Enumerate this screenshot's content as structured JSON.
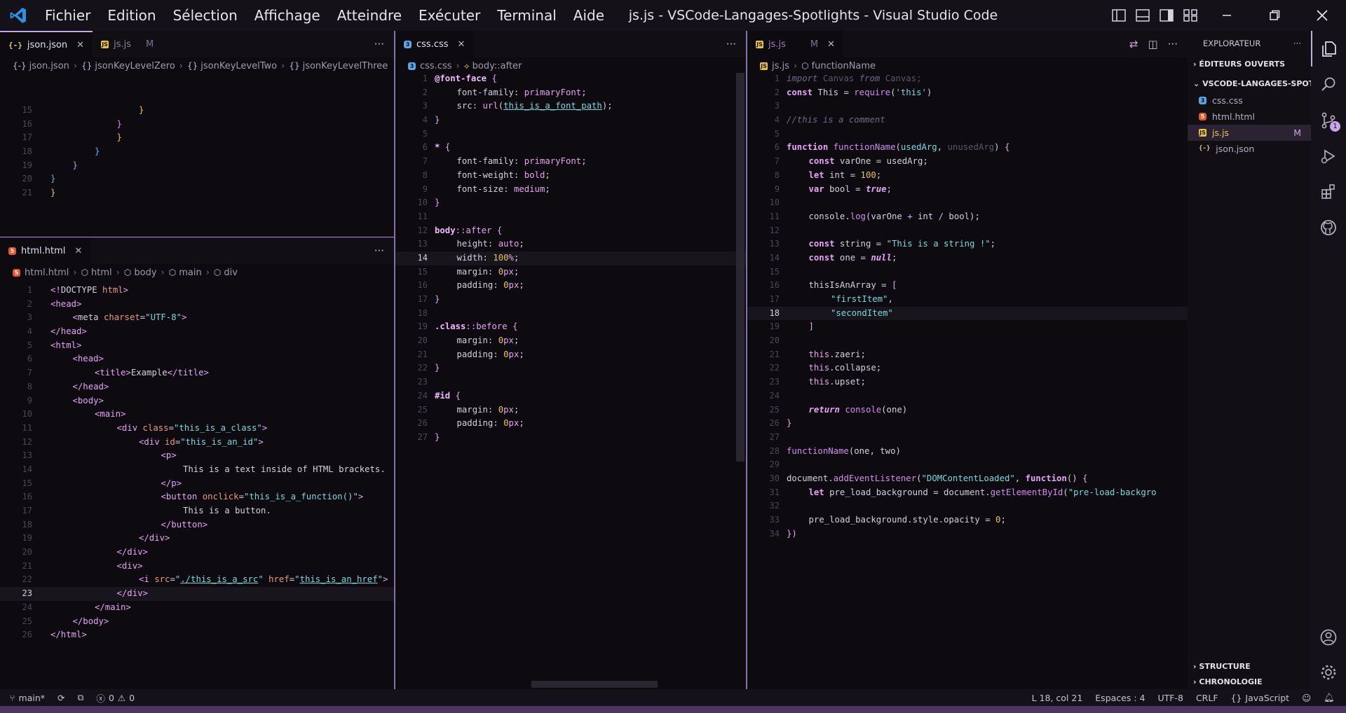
{
  "window": {
    "title": "js.js - VSCode-Langages-Spotlights - Visual Studio Code"
  },
  "menu": [
    "Fichier",
    "Edition",
    "Sélection",
    "Affichage",
    "Atteindre",
    "Exécuter",
    "Terminal",
    "Aide"
  ],
  "icons": {
    "logo": "vscode-logo-icon",
    "close": "close-icon"
  },
  "colors": {
    "accent": "#c9a6e8",
    "keyword": "#e6a3f7",
    "string": "#7ad8e0",
    "number": "#e7c45a"
  },
  "pane_json": {
    "tabs": [
      {
        "label": "json.json"
      },
      {
        "label": "js.js",
        "badge": "M"
      }
    ],
    "breadcrumb": [
      "json.json",
      "jsonKeyLevelZero",
      "jsonKeyLevelTwo",
      "jsonKeyLevelThree"
    ],
    "lines": [
      {
        "n": "15",
        "indent": 4,
        "html": "<span class='brk1'>}</span>"
      },
      {
        "n": "16",
        "indent": 3,
        "html": "<span class='brk2'>}</span>"
      },
      {
        "n": "17",
        "indent": 3,
        "html": "<span class='brk1'>}</span>"
      },
      {
        "n": "18",
        "indent": 2,
        "html": "<span class='brk3'>}</span>"
      },
      {
        "n": "19",
        "indent": 1,
        "html": "<span class='brk2'>}</span>"
      },
      {
        "n": "20",
        "indent": 0,
        "html": "<span class='brk3'>}</span>"
      },
      {
        "n": "21",
        "indent": 0,
        "html": "<span class='brk1'>}</span>"
      }
    ]
  },
  "pane_html": {
    "tabs": [
      {
        "label": "html.html"
      }
    ],
    "breadcrumb": [
      "html.html",
      "html",
      "body",
      "main",
      "div"
    ],
    "lines": [
      {
        "n": "1",
        "i": 0,
        "html": "<span class='tag'>&lt;!</span>DOCTYPE <span class='attr'>html</span><span class='tag'>&gt;</span>"
      },
      {
        "n": "2",
        "i": 0,
        "html": "<span class='tag'>&lt;head&gt;</span>"
      },
      {
        "n": "3",
        "i": 1,
        "html": "<span class='tag'>&lt;</span>meta <span class='attr'>charset</span>=<span class='str'>\"UTF-8\"</span><span class='tag'>&gt;</span>"
      },
      {
        "n": "4",
        "i": 0,
        "html": "<span class='tag'>&lt;/head&gt;</span>"
      },
      {
        "n": "5",
        "i": 0,
        "html": "<span class='tag'>&lt;html&gt;</span>"
      },
      {
        "n": "6",
        "i": 1,
        "html": "<span class='tag'>&lt;head&gt;</span>"
      },
      {
        "n": "7",
        "i": 2,
        "html": "<span class='tag'>&lt;title&gt;</span>Example<span class='tag'>&lt;/title&gt;</span>"
      },
      {
        "n": "8",
        "i": 1,
        "html": "<span class='tag'>&lt;/head&gt;</span>"
      },
      {
        "n": "9",
        "i": 1,
        "html": "<span class='tag'>&lt;body&gt;</span>"
      },
      {
        "n": "10",
        "i": 2,
        "html": "<span class='tag'>&lt;main&gt;</span>"
      },
      {
        "n": "11",
        "i": 3,
        "html": "<span class='tag'>&lt;div</span> <span class='attr'>class</span>=<span class='str'>\"this_is_a_class\"</span><span class='tag'>&gt;</span>"
      },
      {
        "n": "12",
        "i": 4,
        "html": "<span class='tag'>&lt;div</span> <span class='attr'>id</span>=<span class='str'>\"this_is_an_id\"</span><span class='tag'>&gt;</span>"
      },
      {
        "n": "13",
        "i": 5,
        "html": "<span class='tag'>&lt;p&gt;</span>"
      },
      {
        "n": "14",
        "i": 6,
        "html": "This is a text inside of HTML brackets."
      },
      {
        "n": "15",
        "i": 5,
        "html": "<span class='tag'>&lt;/p&gt;</span>"
      },
      {
        "n": "16",
        "i": 5,
        "html": "<span class='tag'>&lt;button</span> <span class='attr'>onclick</span>=<span class='str'>\"this_is_a_function()\"</span><span class='tag'>&gt;</span>"
      },
      {
        "n": "17",
        "i": 6,
        "html": "This is a button."
      },
      {
        "n": "18",
        "i": 5,
        "html": "<span class='tag'>&lt;/button&gt;</span>"
      },
      {
        "n": "19",
        "i": 4,
        "html": "<span class='tag'>&lt;/div&gt;</span>"
      },
      {
        "n": "20",
        "i": 3,
        "html": "<span class='tag'>&lt;/div&gt;</span>"
      },
      {
        "n": "21",
        "i": 3,
        "html": "<span class='tag'>&lt;div&gt;</span>"
      },
      {
        "n": "22",
        "i": 4,
        "html": "<span class='tag'>&lt;i</span> <span class='attr'>src</span>=<span class='str'>\"<span class='link'>./this_is_a_src</span>\"</span> <span class='attr'>href</span>=<span class='str'>\"<span class='link'>this_is_an_href</span>\"</span><span class='tag'>&gt;</span>"
      },
      {
        "n": "23",
        "i": 3,
        "cur": true,
        "html": "<span class='tag'>&lt;/div&gt;</span>"
      },
      {
        "n": "24",
        "i": 2,
        "html": "<span class='tag'>&lt;/main&gt;</span>"
      },
      {
        "n": "25",
        "i": 1,
        "html": "<span class='tag'>&lt;/body&gt;</span>"
      },
      {
        "n": "26",
        "i": 0,
        "html": "<span class='tag'>&lt;/html&gt;</span>"
      }
    ]
  },
  "pane_css": {
    "tabs": [
      {
        "label": "css.css"
      }
    ],
    "breadcrumb": [
      "css.css",
      "body::after"
    ],
    "lines": [
      {
        "n": "1",
        "i": 0,
        "html": "<span class='sel'>@font-face</span> <span class='pun'>{</span>"
      },
      {
        "n": "2",
        "i": 1,
        "html": "font-family: <span class='val'>primaryFont</span>;"
      },
      {
        "n": "3",
        "i": 1,
        "html": "src: <span class='val'>url</span>(<span class='link'>this_is_a_font_path</span>);"
      },
      {
        "n": "4",
        "i": 0,
        "html": "<span class='pun'>}</span>"
      },
      {
        "n": "5",
        "i": 0,
        "html": ""
      },
      {
        "n": "6",
        "i": 0,
        "html": "<span class='sel'>*</span> <span class='pun'>{</span>"
      },
      {
        "n": "7",
        "i": 1,
        "html": "font-family: <span class='val'>primaryFont</span>;"
      },
      {
        "n": "8",
        "i": 1,
        "html": "font-weight: <span class='val'>bold</span>;"
      },
      {
        "n": "9",
        "i": 1,
        "html": "font-size: <span class='val'>medium</span>;"
      },
      {
        "n": "10",
        "i": 0,
        "html": "<span class='pun'>}</span>"
      },
      {
        "n": "11",
        "i": 0,
        "html": ""
      },
      {
        "n": "12",
        "i": 0,
        "html": "<span class='sel'>body</span><span class='pun'>::after</span> <span class='pun'>{</span>"
      },
      {
        "n": "13",
        "i": 1,
        "html": "height: <span class='val'>auto</span>;"
      },
      {
        "n": "14",
        "i": 1,
        "cur": true,
        "html": "width: <span class='num'>100</span><span class='val'>%</span>;"
      },
      {
        "n": "15",
        "i": 1,
        "html": "margin: <span class='num'>0</span><span class='val'>px</span>;"
      },
      {
        "n": "16",
        "i": 1,
        "html": "padding: <span class='num'>0</span><span class='val'>px</span>;"
      },
      {
        "n": "17",
        "i": 0,
        "html": "<span class='pun'>}</span>"
      },
      {
        "n": "18",
        "i": 0,
        "html": ""
      },
      {
        "n": "19",
        "i": 0,
        "html": "<span class='sel'>.class</span><span class='pun'>::before</span> <span class='pun'>{</span>"
      },
      {
        "n": "20",
        "i": 1,
        "html": "margin: <span class='num'>0</span><span class='val'>px</span>;"
      },
      {
        "n": "21",
        "i": 1,
        "html": "padding: <span class='num'>0</span><span class='val'>px</span>;"
      },
      {
        "n": "22",
        "i": 0,
        "html": "<span class='pun'>}</span>"
      },
      {
        "n": "23",
        "i": 0,
        "html": ""
      },
      {
        "n": "24",
        "i": 0,
        "html": "<span class='sel'>#id</span> <span class='pun'>{</span>"
      },
      {
        "n": "25",
        "i": 1,
        "html": "margin: <span class='num'>0</span><span class='val'>px</span>;"
      },
      {
        "n": "26",
        "i": 1,
        "html": "padding: <span class='num'>0</span><span class='val'>px</span>;"
      },
      {
        "n": "27",
        "i": 0,
        "html": "<span class='pun'>}</span>"
      }
    ]
  },
  "pane_js": {
    "tabs": [
      {
        "label": "js.js",
        "badge": "M"
      }
    ],
    "breadcrumb": [
      "js.js",
      "functionName"
    ],
    "lines": [
      {
        "n": "1",
        "i": 0,
        "html": "<span class='cm'>import</span> <span class='dim'>Canvas</span> <span class='cm'>from</span> <span class='dim'>Canvas</span><span class='dim'>;</span>"
      },
      {
        "n": "2",
        "i": 0,
        "html": "<span class='kw'>const</span> This = <span class='fn'>require</span>(<span class='str'>'this'</span>)"
      },
      {
        "n": "3",
        "i": 0,
        "html": ""
      },
      {
        "n": "4",
        "i": 0,
        "html": "<span class='cm'>//this is a comment</span>"
      },
      {
        "n": "5",
        "i": 0,
        "html": ""
      },
      {
        "n": "6",
        "i": 0,
        "html": "<span class='kw'>function</span> <span class='fn'>functionName</span>(<span class='str'>usedArg</span>, <span class='dim'>unusedArg</span>) <span class='pun'>{</span>"
      },
      {
        "n": "7",
        "i": 1,
        "html": "<span class='kw'>const</span> varOne = usedArg;"
      },
      {
        "n": "8",
        "i": 1,
        "html": "<span class='kw'>let</span> int = <span class='num'>100</span>;"
      },
      {
        "n": "9",
        "i": 1,
        "html": "<span class='kw'>var</span> bool = <span class='kwi'>true</span>;"
      },
      {
        "n": "10",
        "i": 0,
        "html": ""
      },
      {
        "n": "11",
        "i": 1,
        "html": "console.<span class='fn'>log</span>(varOne <span class='pun'>+</span> int <span class='pun'>/</span> bool);"
      },
      {
        "n": "12",
        "i": 0,
        "html": ""
      },
      {
        "n": "13",
        "i": 1,
        "html": "<span class='kw'>const</span> string = <span class='str'>\"This is a string !\"</span>;"
      },
      {
        "n": "14",
        "i": 1,
        "html": "<span class='kw'>const</span> one = <span class='kwi'>null</span>;"
      },
      {
        "n": "15",
        "i": 0,
        "html": ""
      },
      {
        "n": "16",
        "i": 1,
        "html": "thisIsAnArray = <span class='pun'>[</span>"
      },
      {
        "n": "17",
        "i": 2,
        "html": "<span class='str'>\"firstItem\"</span>,"
      },
      {
        "n": "18",
        "i": 2,
        "cur": true,
        "html": "<span class='str'>\"secondItem\"</span>"
      },
      {
        "n": "19",
        "i": 1,
        "html": "<span class='pun'>]</span>"
      },
      {
        "n": "20",
        "i": 0,
        "html": ""
      },
      {
        "n": "21",
        "i": 1,
        "html": "<span class='val'>this</span>.zaeri;"
      },
      {
        "n": "22",
        "i": 1,
        "html": "<span class='val'>this</span>.collapse;"
      },
      {
        "n": "23",
        "i": 1,
        "html": "<span class='val'>this</span>.upset;"
      },
      {
        "n": "24",
        "i": 0,
        "html": ""
      },
      {
        "n": "25",
        "i": 1,
        "html": "<span class='kwi'>return</span> <span class='fn'>console</span>(one)"
      },
      {
        "n": "26",
        "i": 0,
        "html": "<span class='pun'>}</span>"
      },
      {
        "n": "27",
        "i": 0,
        "html": ""
      },
      {
        "n": "28",
        "i": 0,
        "html": "<span class='fn'>functionName</span>(one, two)"
      },
      {
        "n": "29",
        "i": 0,
        "html": ""
      },
      {
        "n": "30",
        "i": 0,
        "html": "document.<span class='fn'>addEventListener</span>(<span class='str'>\"DOMContentLoaded\"</span>, <span class='kw'>function</span>() <span class='pun'>{</span>"
      },
      {
        "n": "31",
        "i": 1,
        "html": "<span class='kw'>let</span> pre_load_background = document.<span class='fn'>getElementById</span>(<span class='str'>\"pre-load-backgro</span>"
      },
      {
        "n": "32",
        "i": 0,
        "html": ""
      },
      {
        "n": "33",
        "i": 1,
        "html": "pre_load_background.style.opacity = <span class='num'>0</span>;"
      },
      {
        "n": "34",
        "i": 0,
        "html": "<span class='pun'>})</span>"
      }
    ]
  },
  "sidebar": {
    "title": "EXPLORATEUR",
    "sections": {
      "open": "ÉDITEURS OUVERTS",
      "workspace": "VSCODE-LANGAGES-SPOT...",
      "outline": "STRUCTURE",
      "timeline": "CHRONOLOGIE"
    },
    "files": [
      {
        "label": "css.css",
        "icon": "css"
      },
      {
        "label": "html.html",
        "icon": "html"
      },
      {
        "label": "js.js",
        "icon": "js",
        "badge": "M"
      },
      {
        "label": "json.json",
        "icon": "json"
      }
    ]
  },
  "activity": {
    "scm_badge": "1"
  },
  "status": {
    "branch": "main*",
    "errors": "0",
    "warnings": "0",
    "position": "L 18, col 21",
    "spaces": "Espaces : 4",
    "encoding": "UTF-8",
    "eol": "CRLF",
    "language": "JavaScript"
  }
}
